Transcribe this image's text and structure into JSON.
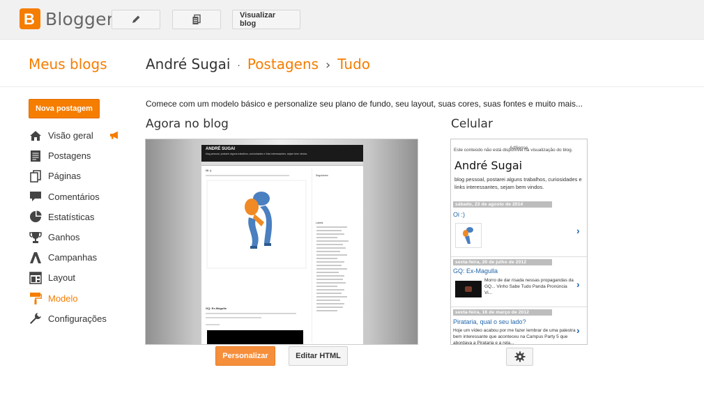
{
  "app": {
    "brand": "Blogger",
    "brand_letter": "B",
    "accent": "#f57d00"
  },
  "toolbar": {
    "edit_icon": "pencil-icon",
    "posts_icon": "documents-icon",
    "view_blog_label": "Visualizar blog"
  },
  "header": {
    "my_blogs": "Meus blogs",
    "blog_name": "André Sugai",
    "dot": "·",
    "section": "Postagens",
    "separator": "›",
    "subsection": "Tudo"
  },
  "sidebar": {
    "new_post_label": "Nova postagem",
    "items": [
      {
        "label": "Visão geral",
        "icon": "home-icon"
      },
      {
        "label": "Postagens",
        "icon": "posts-icon"
      },
      {
        "label": "Páginas",
        "icon": "pages-icon"
      },
      {
        "label": "Comentários",
        "icon": "comment-icon"
      },
      {
        "label": "Estatísticas",
        "icon": "pie-chart-icon"
      },
      {
        "label": "Ganhos",
        "icon": "trophy-icon"
      },
      {
        "label": "Campanhas",
        "icon": "campaign-icon"
      },
      {
        "label": "Layout",
        "icon": "layout-icon"
      },
      {
        "label": "Modelo",
        "icon": "paint-roller-icon",
        "active": true
      },
      {
        "label": "Configurações",
        "icon": "wrench-icon"
      }
    ]
  },
  "main": {
    "intro": "Comece com um modelo básico e personalize seu plano de fundo, seu layout, suas cores, suas fontes e muito mais...",
    "now_on_blog_title": "Agora no blog",
    "mobile_title": "Celular",
    "customize_label": "Personalizar",
    "edit_html_label": "Editar HTML",
    "settings_icon": "gear-icon"
  },
  "preview": {
    "blog_title": "ANDRÉ SUGAI",
    "blog_tagline": "blog pessoal, postarei alguns trabalhos, curiosidades e links interessantes, sejam bem vindos.",
    "post1_title": "Oi :)",
    "post2_title": "GQ: Ex-Magulla",
    "side_heading": "Seguidores",
    "labels_heading": "Labels"
  },
  "mobile": {
    "warning": "Este conteúdo não está disponível na visualização do blog.",
    "warning_overlay": "AdSense",
    "blog_title": "André Sugai",
    "blog_desc": "blog pessoal, postarei alguns trabalhos, curiosidades e links interessantes, sejam bem vindos.",
    "posts": [
      {
        "date": "sábado, 23 de agosto de 2014",
        "title": "Oi :)",
        "snippet": ""
      },
      {
        "date": "sexta-feira, 20 de julho de 2012",
        "title": "GQ: Ex-Magulla",
        "snippet": "Morro de dar risada nessas propagandas da GQ... Vinho Sabe Tudo Panda Pronúncia Vi..."
      },
      {
        "date": "sexta-feira, 16 de março de 2012",
        "title": "Pirataria, qual o seu lado?",
        "snippet": "Hoje um vídeo acabou por me fazer lembrar de uma palestra bem interessante que aconteceu na Campus Party 5 que abordava a Pirataria e a rela..."
      }
    ],
    "chevron": "›"
  }
}
